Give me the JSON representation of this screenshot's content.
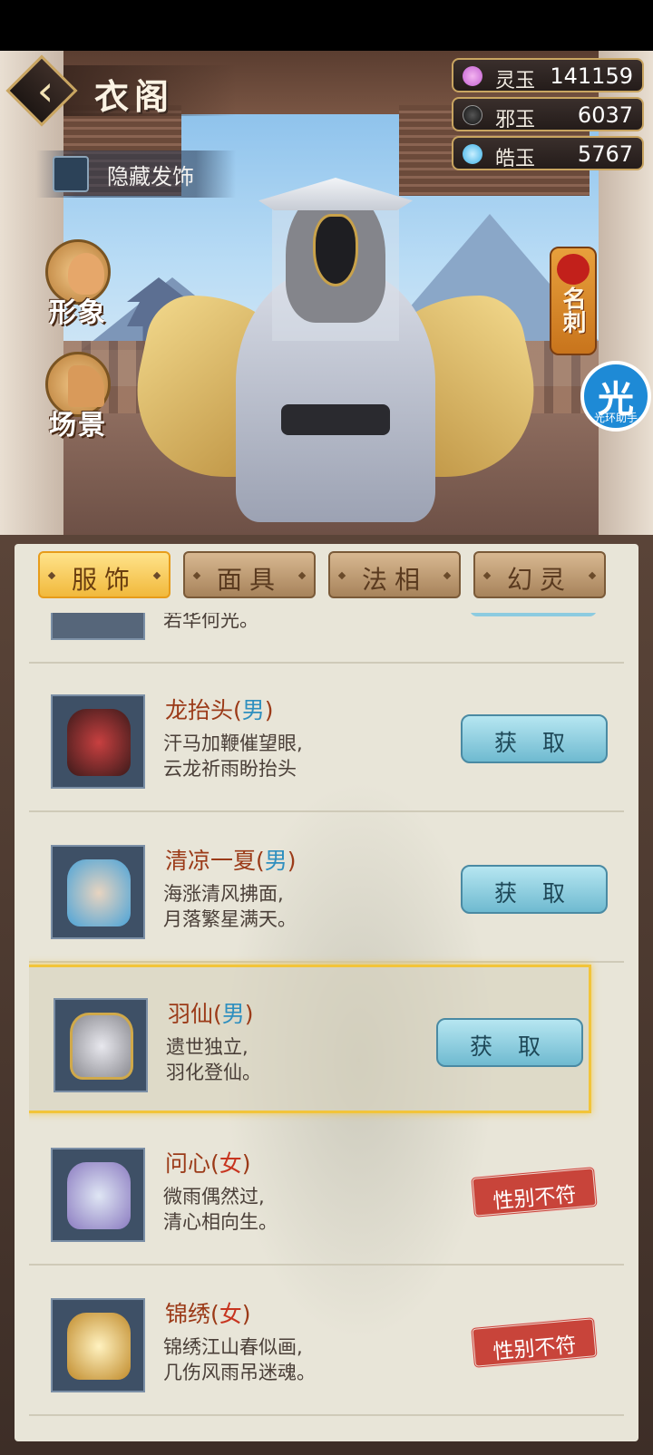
{
  "header": {
    "title": "衣阁",
    "hide_accessory_label": "隐藏发饰"
  },
  "currencies": [
    {
      "name": "灵玉",
      "value": "141159",
      "icon": "purple-jade-icon",
      "color": "#c25fd1"
    },
    {
      "name": "邪玉",
      "value": "6037",
      "icon": "dark-jade-icon",
      "color": "#1a1a1a"
    },
    {
      "name": "皓玉",
      "value": "5767",
      "icon": "blue-jade-icon",
      "color": "#3ab0e6"
    }
  ],
  "side_buttons": [
    {
      "label": "形象",
      "icon": "appearance-icon"
    },
    {
      "label": "场景",
      "icon": "scene-icon"
    }
  ],
  "namecard": {
    "label": "名刺"
  },
  "helper": {
    "glyph": "光",
    "caption": "光环助手"
  },
  "tabs": [
    {
      "label": "服饰",
      "active": true
    },
    {
      "label": "面具",
      "active": false
    },
    {
      "label": "法相",
      "active": false
    },
    {
      "label": "幻灵",
      "active": false
    }
  ],
  "partial_row": {
    "text": "若华何光。"
  },
  "items": [
    {
      "name": "龙抬头",
      "gender": "男",
      "desc1": "汗马加鞭催望眼,",
      "desc2": "云龙祈雨盼抬头",
      "action": "获 取",
      "action_type": "get",
      "thumb_color": "#8a2a2a"
    },
    {
      "name": "清凉一夏",
      "gender": "男",
      "desc1": "海涨清风拂面,",
      "desc2": "月落繁星满天。",
      "action": "获 取",
      "action_type": "get",
      "thumb_color": "#4aa3d8"
    },
    {
      "name": "羽仙",
      "gender": "男",
      "desc1": "遗世独立,",
      "desc2": "羽化登仙。",
      "action": "获 取",
      "action_type": "get",
      "thumb_color": "#b8b8bf",
      "selected": true
    },
    {
      "name": "问心",
      "gender": "女",
      "desc1": "微雨偶然过,",
      "desc2": "清心相向生。",
      "action": "性别不符",
      "action_type": "mismatch",
      "thumb_color": "#a9b6d8"
    },
    {
      "name": "锦绣",
      "gender": "女",
      "desc1": "锦绣江山春似画,",
      "desc2": "几伤风雨吊迷魂。",
      "action": "性别不符",
      "action_type": "mismatch",
      "thumb_color": "#e0b24a"
    }
  ]
}
